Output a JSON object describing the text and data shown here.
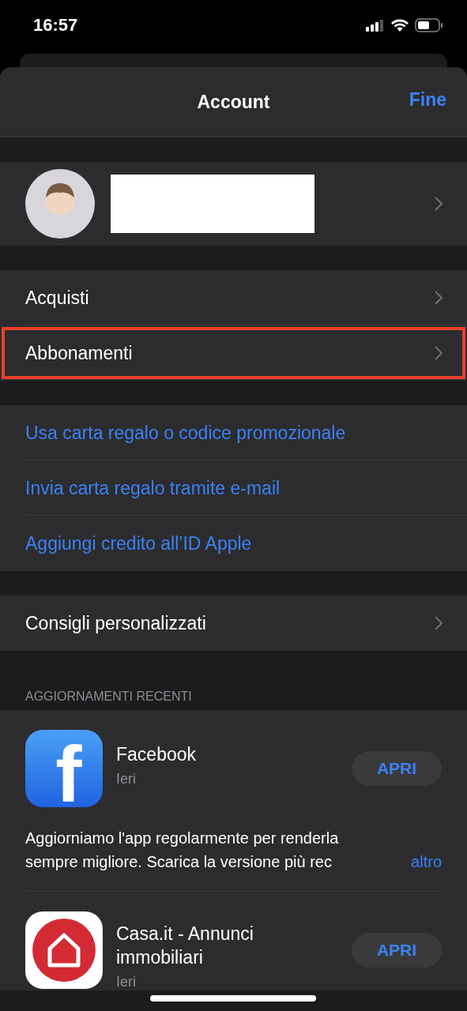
{
  "status_bar": {
    "time": "16:57"
  },
  "header": {
    "title": "Account",
    "done": "Fine"
  },
  "profile": {
    "redacted": true
  },
  "menu_groups": [
    {
      "items": [
        {
          "label": "Acquisti",
          "kind": "nav",
          "highlighted": false
        },
        {
          "label": "Abbonamenti",
          "kind": "nav",
          "highlighted": true
        }
      ]
    },
    {
      "items": [
        {
          "label": "Usa carta regalo o codice promozionale",
          "kind": "link",
          "highlighted": false
        },
        {
          "label": "Invia carta regalo tramite e-mail",
          "kind": "link",
          "highlighted": false
        },
        {
          "label": "Aggiungi credito all’ID Apple",
          "kind": "link",
          "highlighted": false
        }
      ]
    },
    {
      "items": [
        {
          "label": "Consigli personalizzati",
          "kind": "nav",
          "highlighted": false
        }
      ]
    }
  ],
  "recent_updates": {
    "heading": "AGGIORNAMENTI RECENTI",
    "apps": [
      {
        "name": "Facebook",
        "date": "Ieri",
        "button": "APRI",
        "kind": "glyph",
        "glyph": "f",
        "notes": "Aggiorniamo l'app regolarmente per renderla sempre migliore. Scarica la versione più rec",
        "more": "altro"
      },
      {
        "name": "Casa.it - Annunci immobiliari",
        "date": "Ieri",
        "button": "APRI",
        "kind": "house"
      }
    ]
  }
}
